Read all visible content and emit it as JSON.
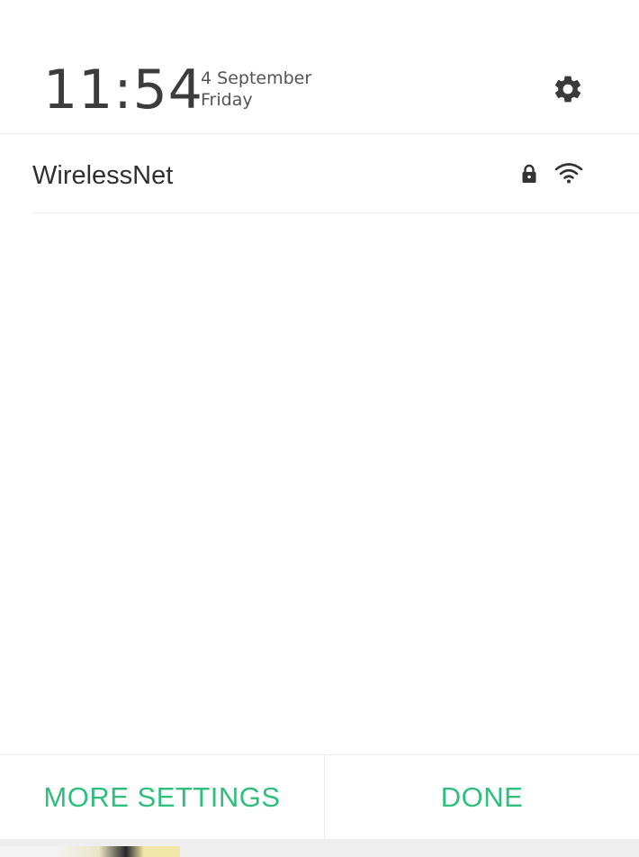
{
  "header": {
    "time": "11:54",
    "date": "4 September",
    "day": "Friday",
    "settings_icon": "gear-icon"
  },
  "networks": [
    {
      "name": "WirelessNet",
      "secured": true,
      "lock_icon": "lock-icon",
      "signal_icon": "wifi-icon",
      "signal_strength": 1.0
    }
  ],
  "actions": {
    "more_settings_label": "MORE SETTINGS",
    "done_label": "DONE"
  },
  "colors": {
    "accent": "#2fbf7d",
    "text_primary": "#303030",
    "text_secondary": "#545454",
    "icon": "#3a3a3a",
    "divider": "#ececec"
  }
}
